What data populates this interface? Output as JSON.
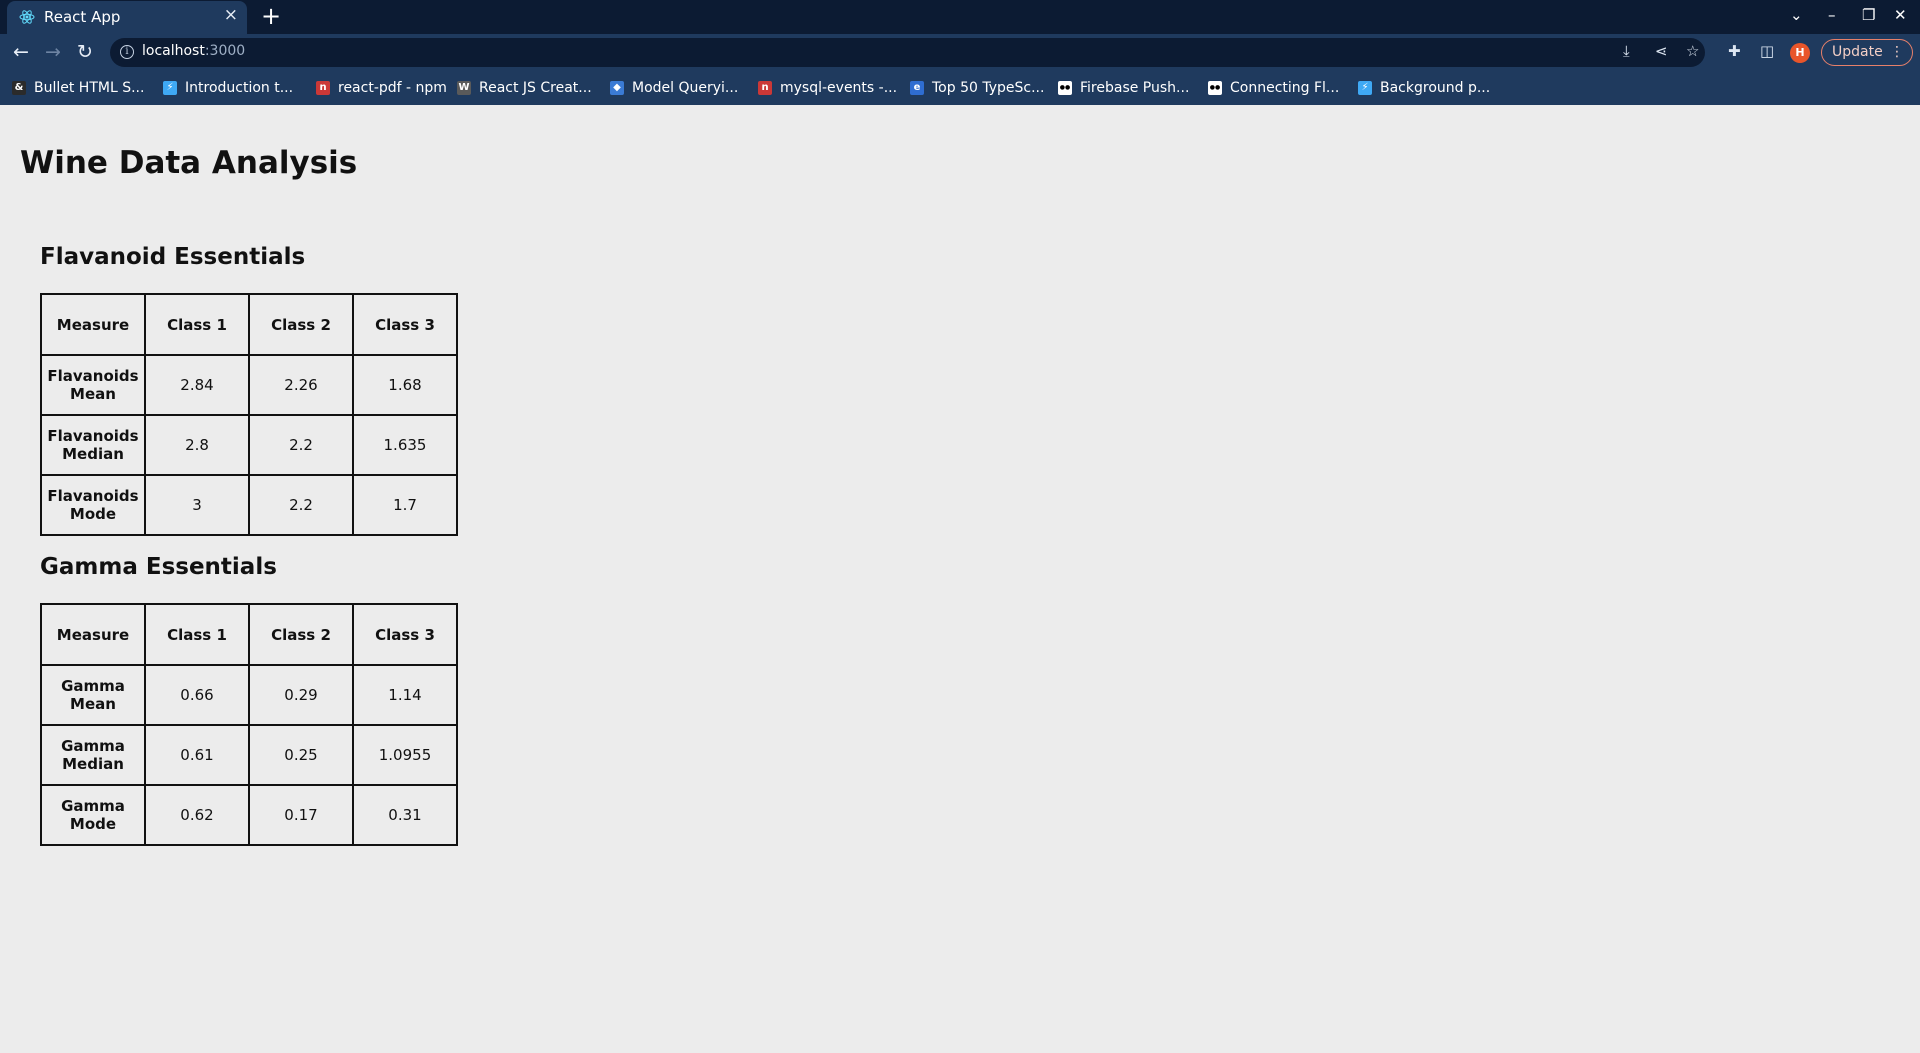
{
  "browser": {
    "tab_title": "React App",
    "url_host": "localhost",
    "url_port": ":3000",
    "update_label": "Update",
    "avatar_letter": "H",
    "bookmarks": [
      {
        "label": "Bullet HTML S...",
        "icon": "generic-favicon",
        "color": "#2b2b2b"
      },
      {
        "label": "Introduction t...",
        "icon": "flutter-favicon",
        "color": "#3fa9f5"
      },
      {
        "label": "react-pdf - npm",
        "icon": "npm-favicon",
        "color": "#cb3837"
      },
      {
        "label": "React JS Creat...",
        "icon": "wordpress-favicon",
        "color": "#5a5a5a"
      },
      {
        "label": "Model Queryi...",
        "icon": "sequelize-favicon",
        "color": "#3b7bd5"
      },
      {
        "label": "mysql-events -...",
        "icon": "npm-favicon",
        "color": "#cb3837"
      },
      {
        "label": "Top 50 TypeSc...",
        "icon": "el-favicon",
        "color": "#2f6dd1"
      },
      {
        "label": "Firebase Push...",
        "icon": "medium-favicon",
        "color": "#000000"
      },
      {
        "label": "Connecting Fl...",
        "icon": "medium-favicon",
        "color": "#000000"
      },
      {
        "label": "Background p...",
        "icon": "flutter-favicon",
        "color": "#3fa9f5"
      }
    ]
  },
  "page": {
    "title": "Wine Data Analysis",
    "flavanoid": {
      "title": "Flavanoid Essentials",
      "headers": [
        "Measure",
        "Class 1",
        "Class 2",
        "Class 3"
      ],
      "rows": [
        {
          "measure": "Flavanoids Mean",
          "values": [
            "2.84",
            "2.26",
            "1.68"
          ]
        },
        {
          "measure": "Flavanoids Median",
          "values": [
            "2.8",
            "2.2",
            "1.635"
          ]
        },
        {
          "measure": "Flavanoids Mode",
          "values": [
            "3",
            "2.2",
            "1.7"
          ]
        }
      ]
    },
    "gamma": {
      "title": "Gamma Essentials",
      "headers": [
        "Measure",
        "Class 1",
        "Class 2",
        "Class 3"
      ],
      "rows": [
        {
          "measure": "Gamma Mean",
          "values": [
            "0.66",
            "0.29",
            "1.14"
          ]
        },
        {
          "measure": "Gamma Median",
          "values": [
            "0.61",
            "0.25",
            "1.0955"
          ]
        },
        {
          "measure": "Gamma Mode",
          "values": [
            "0.62",
            "0.17",
            "0.31"
          ]
        }
      ]
    }
  }
}
